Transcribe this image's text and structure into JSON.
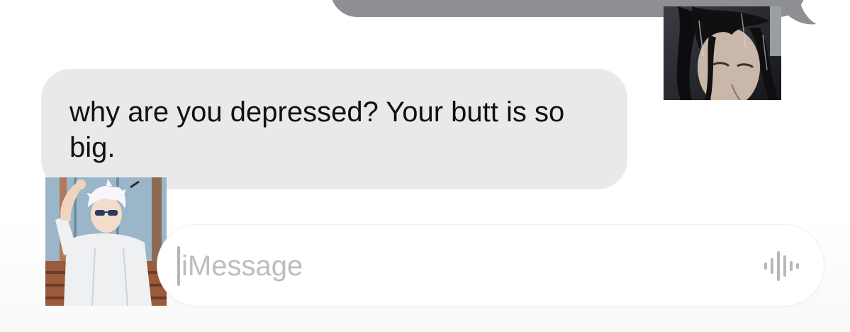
{
  "conversation": {
    "incoming_message": "why are you depressed? Your butt is so big."
  },
  "composer": {
    "placeholder": "iMessage",
    "voice_icon": "waveform-icon"
  },
  "colors": {
    "sent_bubble": "#8e8e93",
    "received_bubble": "#e9e9eb",
    "placeholder": "#bdbdc0"
  }
}
